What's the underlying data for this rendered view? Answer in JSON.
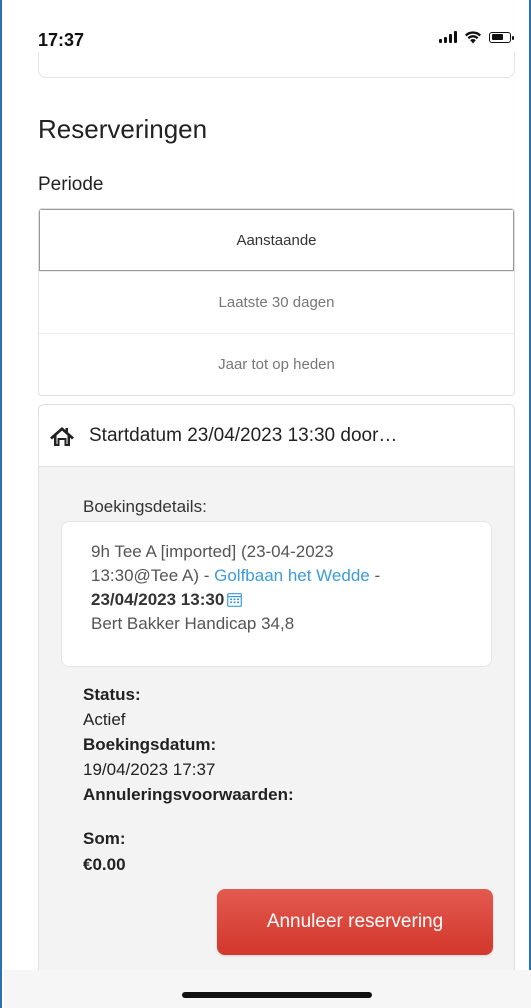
{
  "status_bar": {
    "time": "17:37",
    "icons": [
      "signal-icon",
      "wifi-icon",
      "battery-icon"
    ]
  },
  "page": {
    "title": "Reserveringen",
    "periode_label": "Periode",
    "periods": [
      {
        "label": "Aanstaande",
        "selected": true
      },
      {
        "label": "Laatste 30 dagen",
        "selected": false
      },
      {
        "label": "Jaar tot op heden",
        "selected": false
      }
    ]
  },
  "booking": {
    "header_icon": "home-icon",
    "header_title": "Startdatum 23/04/2023 13:30 door…",
    "details_label": "Boekingsdetails:",
    "details": {
      "line1": "9h Tee A [imported] (23-04-2023",
      "line2_prefix": "13:30@Tee A) - ",
      "course_link": "Golfbaan het Wedde",
      "line2_suffix": " -",
      "datetime": "23/04/2023 13:30",
      "calendar_icon": "calendar-icon",
      "player": "Bert Bakker Handicap 34,8"
    },
    "status_label": "Status:",
    "status_value": "Actief",
    "booking_date_label": "Boekingsdatum:",
    "booking_date_value": "19/04/2023 17:37",
    "cancel_conditions_label": "Annuleringsvoorwaarden:",
    "sum_label": "Som:",
    "sum_value": "€0.00",
    "cancel_button": "Annuleer reservering"
  },
  "colors": {
    "link": "#3d9bd9",
    "cancel_button": "#d9463b",
    "frame_border": "#2f6fb3"
  }
}
